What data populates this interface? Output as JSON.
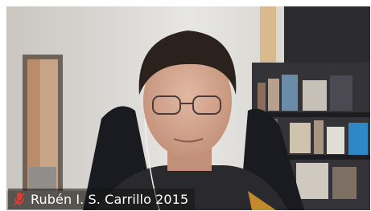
{
  "participant": {
    "display_name": "Rubén I. S. Carrillo 2015",
    "mic_status_icon": "muted-mic-icon"
  },
  "colors": {
    "muted_mic": "#e5392f",
    "name_text": "#ffffff"
  }
}
